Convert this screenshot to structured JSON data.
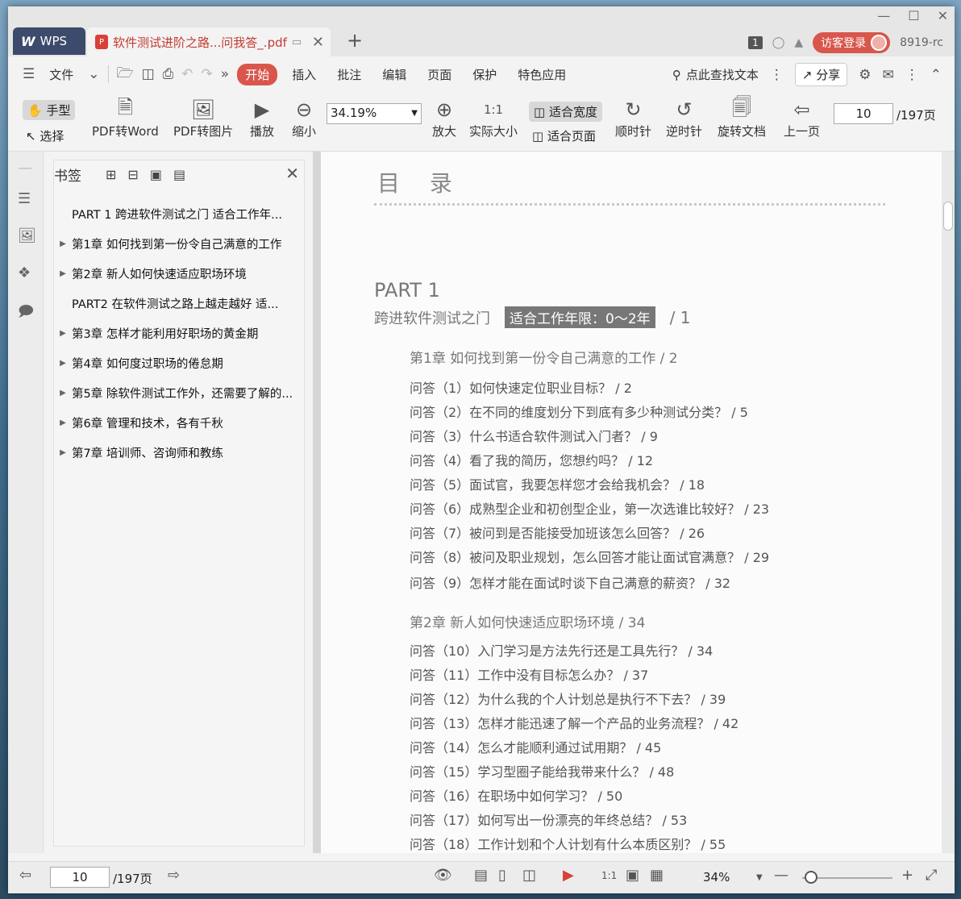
{
  "titlebar": {
    "wps_tab": "WPS",
    "doc_tab": "软件测试进阶之路...问我答_.pdf",
    "page_badge": "1",
    "login": "访客登录",
    "version": "8919-rc"
  },
  "menubar": {
    "file": "文件",
    "tabs": [
      "开始",
      "插入",
      "批注",
      "编辑",
      "页面",
      "保护",
      "特色应用"
    ],
    "search": "点此查找文本",
    "share": "分享"
  },
  "toolbar": {
    "hand": "手型",
    "select": "选择",
    "pdf_to_word": "PDF转Word",
    "pdf_to_image": "PDF转图片",
    "play": "播放",
    "zoom_out": "缩小",
    "zoom_value": "34.19%",
    "zoom_in": "放大",
    "actual_size": "实际大小",
    "fit_width": "适合宽度",
    "fit_page": "适合页面",
    "clockwise": "顺时针",
    "counterclockwise": "逆时针",
    "rotate_doc": "旋转文档",
    "prev_page": "上一页",
    "page_value": "10",
    "page_total": "/197页"
  },
  "bookmarks": {
    "title": "书签",
    "items": [
      {
        "label": "PART 1  跨进软件测试之门  适合工作年...",
        "expandable": false
      },
      {
        "label": "第1章  如何找到第一份令自己满意的工作",
        "expandable": true
      },
      {
        "label": "第2章  新人如何快速适应职场环境",
        "expandable": true
      },
      {
        "label": "PART2  在软件测试之路上越走越好  适...",
        "expandable": false
      },
      {
        "label": "第3章  怎样才能利用好职场的黄金期",
        "expandable": true
      },
      {
        "label": "第4章  如何度过职场的倦怠期",
        "expandable": true
      },
      {
        "label": "第5章  除软件测试工作外，还需要了解的...",
        "expandable": true
      },
      {
        "label": "第6章  管理和技术，各有千秋",
        "expandable": true
      },
      {
        "label": "第7章  培训师、咨询师和教练",
        "expandable": true
      }
    ]
  },
  "document": {
    "heading": "目  录",
    "part_label": "PART 1",
    "part_title": "跨进软件测试之门",
    "part_tag": "适合工作年限：0～2年",
    "part_page": "/ 1",
    "chapter1": "第1章   如何找到第一份令自己满意的工作 / 2",
    "chapter1_qa": [
      "问答（1）如何快速定位职业目标？ / 2",
      "问答（2）在不同的维度划分下到底有多少种测试分类？ / 5",
      "问答（3）什么书适合软件测试入门者？ / 9",
      "问答（4）看了我的简历，您想约吗？ / 12",
      "问答（5）面试官，我要怎样您才会给我机会？ / 18",
      "问答（6）成熟型企业和初创型企业，第一次选谁比较好？ / 23",
      "问答（7）被问到是否能接受加班该怎么回答？ / 26",
      "问答（8）被问及职业规划，怎么回答才能让面试官满意？ / 29",
      "问答（9）怎样才能在面试时谈下自己满意的薪资？ / 32"
    ],
    "chapter2": "第2章   新人如何快速适应职场环境 / 34",
    "chapter2_qa": [
      "问答（10）入门学习是方法先行还是工具先行？ / 34",
      "问答（11）工作中没有目标怎么办？ / 37",
      "问答（12）为什么我的个人计划总是执行不下去？ / 39",
      "问答（13）怎样才能迅速了解一个产品的业务流程？ / 42",
      "问答（14）怎么才能顺利通过试用期？ / 45",
      "问答（15）学习型圈子能给我带来什么？ / 48",
      "问答（16）在职场中如何学习？ / 50",
      "问答（17）如何写出一份漂亮的年终总结？ / 53",
      "问答（18）工作计划和个人计划有什么本质区别？ / 55"
    ]
  },
  "statusbar": {
    "page_value": "10",
    "page_total": "/197页",
    "zoom": "34%"
  },
  "colors": {
    "accent": "#d9564c",
    "wps_tab": "#3c4a6b"
  }
}
